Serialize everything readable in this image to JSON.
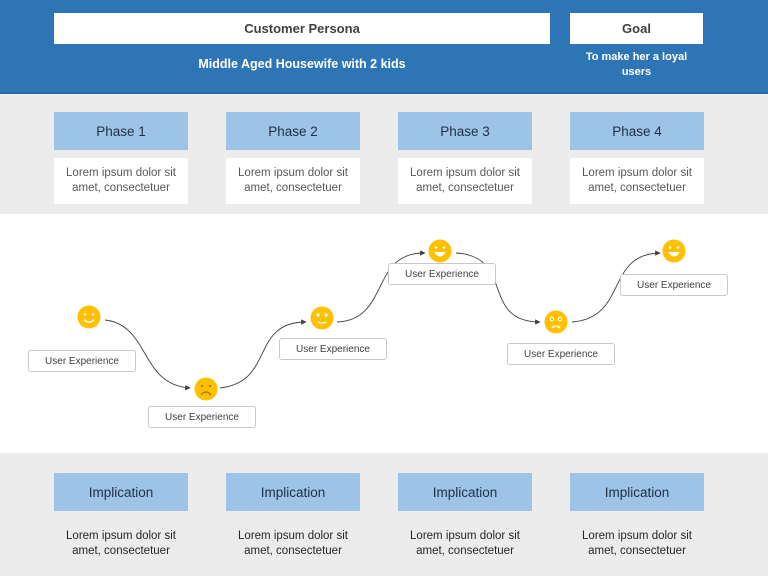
{
  "header": {
    "persona_label": "Customer Persona",
    "persona_value": "Middle Aged Housewife with 2 kids",
    "goal_label": "Goal",
    "goal_value": "To make her a loyal users"
  },
  "phases": [
    {
      "title": "Phase 1",
      "description": "Lorem ipsum dolor sit amet, consectetuer"
    },
    {
      "title": "Phase 2",
      "description": "Lorem ipsum dolor sit amet, consectetuer"
    },
    {
      "title": "Phase 3",
      "description": "Lorem ipsum dolor sit amet, consectetuer"
    },
    {
      "title": "Phase 4",
      "description": "Lorem ipsum dolor sit amet, consectetuer"
    }
  ],
  "journey": {
    "steps": [
      {
        "label": "User Experience",
        "mood": "happy"
      },
      {
        "label": "User Experience",
        "mood": "sad"
      },
      {
        "label": "User Experience",
        "mood": "neutral-smile"
      },
      {
        "label": "User Experience",
        "mood": "very-happy"
      },
      {
        "label": "User Experience",
        "mood": "worried"
      },
      {
        "label": "User Experience",
        "mood": "very-happy"
      }
    ],
    "emoji_color": "#ffc000",
    "connector_color": "#404040"
  },
  "implications": [
    {
      "title": "Implication",
      "description": "Lorem ipsum dolor sit amet, consectetuer"
    },
    {
      "title": "Implication",
      "description": "Lorem ipsum dolor sit amet, consectetuer"
    },
    {
      "title": "Implication",
      "description": "Lorem ipsum dolor sit amet, consectetuer"
    },
    {
      "title": "Implication",
      "description": "Lorem ipsum dolor sit amet, consectetuer"
    }
  ],
  "colors": {
    "header_bg": "#2e75b6",
    "box_blue": "#9dc3e6",
    "band_gray": "#ececec"
  }
}
